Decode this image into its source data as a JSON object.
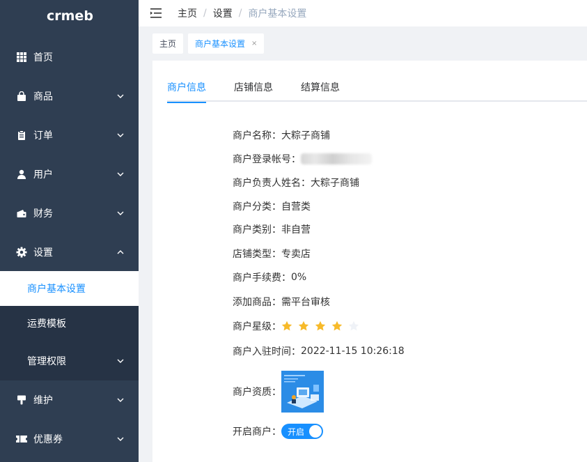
{
  "brand": {
    "logo_text": "crmeb"
  },
  "sidebar": {
    "items": [
      {
        "label": "首页"
      },
      {
        "label": "商品"
      },
      {
        "label": "订单"
      },
      {
        "label": "用户"
      },
      {
        "label": "财务"
      },
      {
        "label": "设置"
      },
      {
        "label": "维护"
      },
      {
        "label": "优惠券"
      }
    ],
    "sub_items": [
      {
        "label": "商户基本设置"
      },
      {
        "label": "运费模板"
      },
      {
        "label": "管理权限"
      }
    ]
  },
  "header": {
    "breadcrumb": [
      "主页",
      "设置",
      "商户基本设置"
    ],
    "sep": "/"
  },
  "tagbar": {
    "tags": [
      {
        "label": "主页"
      },
      {
        "label": "商户基本设置"
      }
    ],
    "close": "×"
  },
  "tabs": [
    "商户信息",
    "店铺信息",
    "结算信息"
  ],
  "info": {
    "name_label": "商户名称：",
    "name_value": "大粽子商铺",
    "account_label": "商户登录帐号：",
    "owner_label": "商户负责人姓名：",
    "owner_value": "大粽子商铺",
    "category_label": "商户分类：",
    "category_value": "自营类",
    "type_label": "商户类别：",
    "type_value": "非自营",
    "store_type_label": "店铺类型：",
    "store_type_value": "专卖店",
    "fee_label": "商户手续费：",
    "fee_value": "0%",
    "add_goods_label": "添加商品：",
    "add_goods_value": "需平台审核",
    "rating_label": "商户星级：",
    "rating": {
      "value": 4,
      "max": 5
    },
    "join_label": "商户入驻时间：",
    "join_value": "2022-11-15 10:26:18",
    "qualification_label": "商户资质：",
    "enable_label": "开启商户：",
    "enable_value": "开启"
  },
  "colors": {
    "primary": "#1890ff",
    "sidebar": "#2f3e52",
    "star_on": "#f7ba2a",
    "star_off": "#eff2f7"
  }
}
